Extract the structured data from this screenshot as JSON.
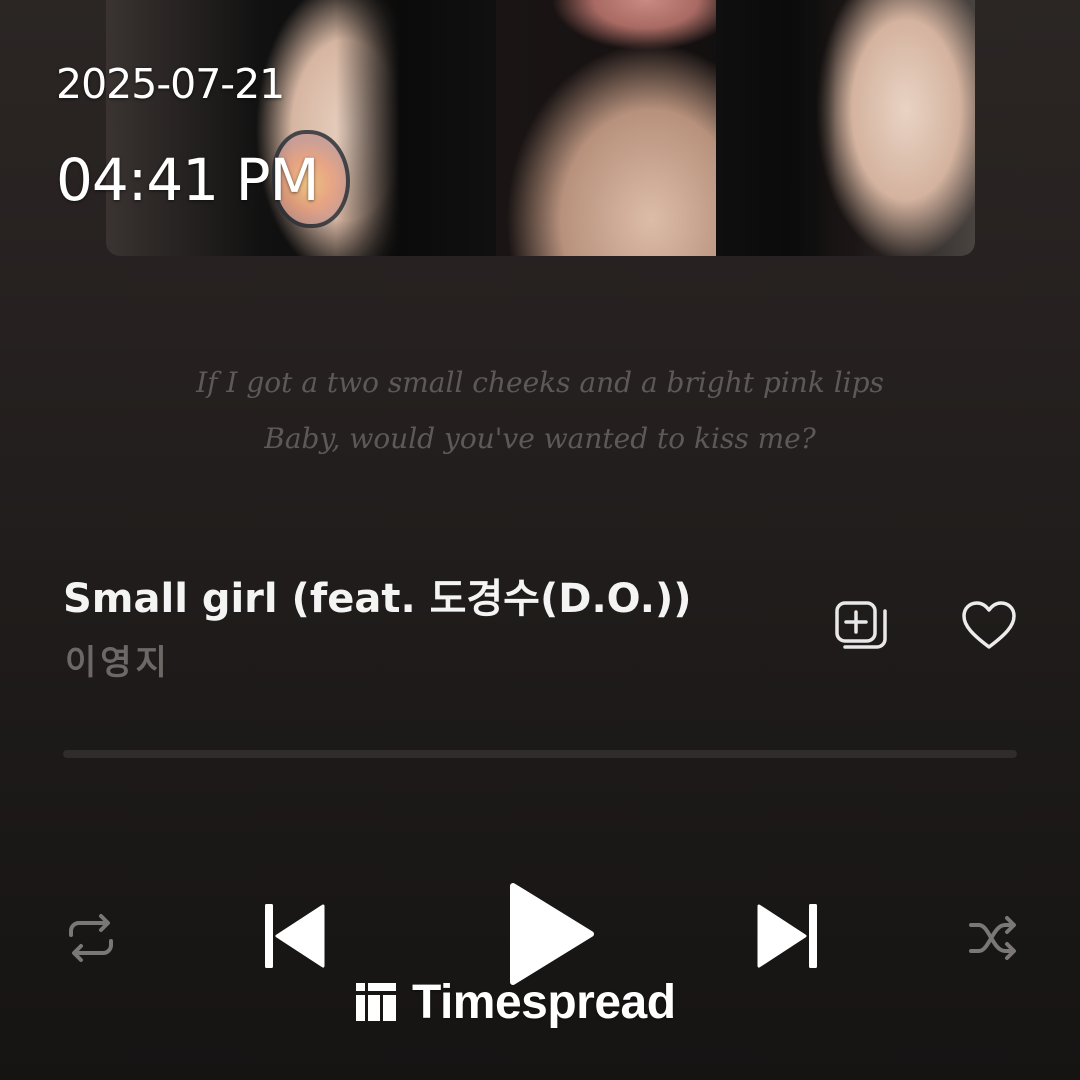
{
  "status_overlay": {
    "date": "2025-07-21",
    "time": "04:41 PM"
  },
  "lyrics": {
    "lines": [
      "If I got a two small cheeks and a bright pink lips",
      "Baby, would you've wanted to kiss me?"
    ]
  },
  "track": {
    "title": "Small girl (feat. 도경수(D.O.))",
    "artist": "이영지"
  },
  "playback": {
    "progress_fraction": 0.0,
    "state": "paused"
  },
  "icons": {
    "add_to_playlist": "add-to-playlist-icon",
    "like": "heart-outline-icon",
    "repeat": "repeat-icon",
    "previous": "skip-previous-icon",
    "play": "play-icon",
    "next": "skip-next-icon",
    "shuffle": "shuffle-icon",
    "watermark_logo": "timespread-logo-icon"
  },
  "watermark": {
    "text": "Timespread"
  },
  "colors": {
    "background_top": "#2b2624",
    "background_bottom": "#161413",
    "primary_text": "#f4f4f4",
    "secondary_text": "#6b6866",
    "lyrics_text": "#5d5957",
    "inactive_icon": "#7a7776"
  }
}
